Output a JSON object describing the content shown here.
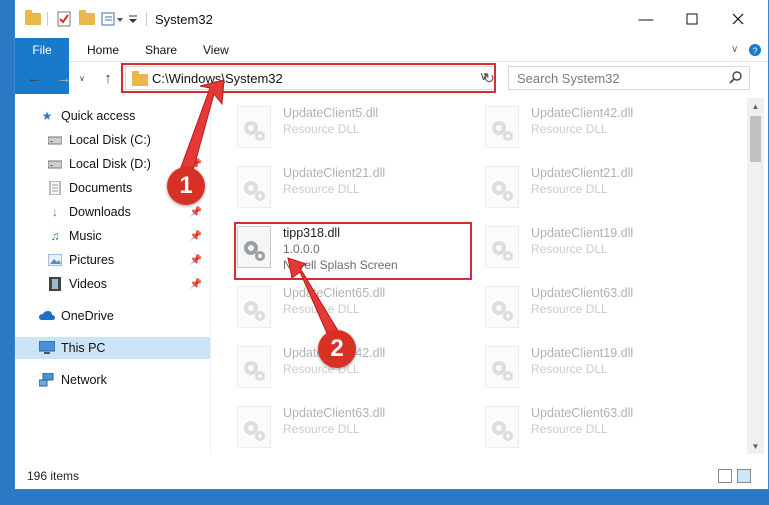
{
  "window": {
    "title": "System32"
  },
  "ribbon": {
    "tabs": [
      "File",
      "Home",
      "Share",
      "View"
    ]
  },
  "address": {
    "path": "C:\\Windows\\System32"
  },
  "search": {
    "placeholder": "Search System32"
  },
  "nav": {
    "items": [
      {
        "label": "Quick access",
        "icon": "star-icon",
        "pinned": false
      },
      {
        "label": "Local Disk (C:)",
        "icon": "drive-icon",
        "pinned": true
      },
      {
        "label": "Local Disk (D:)",
        "icon": "drive-icon",
        "pinned": true
      },
      {
        "label": "Documents",
        "icon": "document-icon",
        "pinned": true
      },
      {
        "label": "Downloads",
        "icon": "download-icon",
        "pinned": true
      },
      {
        "label": "Music",
        "icon": "music-icon",
        "pinned": true
      },
      {
        "label": "Pictures",
        "icon": "picture-icon",
        "pinned": true
      },
      {
        "label": "Videos",
        "icon": "video-icon",
        "pinned": true
      },
      {
        "label": "OneDrive",
        "icon": "cloud-icon",
        "pinned": false
      },
      {
        "label": "This PC",
        "icon": "computer-icon",
        "pinned": false
      },
      {
        "label": "Network",
        "icon": "network-icon",
        "pinned": false
      }
    ]
  },
  "files": {
    "col1": [
      {
        "name": "UpdateClient5.dll",
        "desc": "Resource DLL"
      },
      {
        "name": "UpdateClient21.dll",
        "desc": "Resource DLL"
      },
      {
        "name": "tipp318.dll",
        "desc": "1.0.0.0",
        "desc2": "Novell Splash Screen"
      },
      {
        "name": "UpdateClient65.dll",
        "desc": "Resource DLL"
      },
      {
        "name": "UpdateClient42.dll",
        "desc": "Resource DLL"
      },
      {
        "name": "UpdateClient63.dll",
        "desc": "Resource DLL"
      }
    ],
    "col2": [
      {
        "name": "UpdateClient42.dll",
        "desc": "Resource DLL"
      },
      {
        "name": "UpdateClient21.dll",
        "desc": "Resource DLL"
      },
      {
        "name": "UpdateClient19.dll",
        "desc": "Resource DLL"
      },
      {
        "name": "UpdateClient63.dll",
        "desc": "Resource DLL"
      },
      {
        "name": "UpdateClient19.dll",
        "desc": "Resource DLL"
      },
      {
        "name": "UpdateClient63.dll",
        "desc": "Resource DLL"
      }
    ]
  },
  "status": {
    "count": "196 items"
  },
  "annotations": {
    "step1": "1",
    "step2": "2"
  },
  "colors": {
    "accent": "#1979ca",
    "highlight": "#d32f2f",
    "selected": "#cce4f7"
  }
}
